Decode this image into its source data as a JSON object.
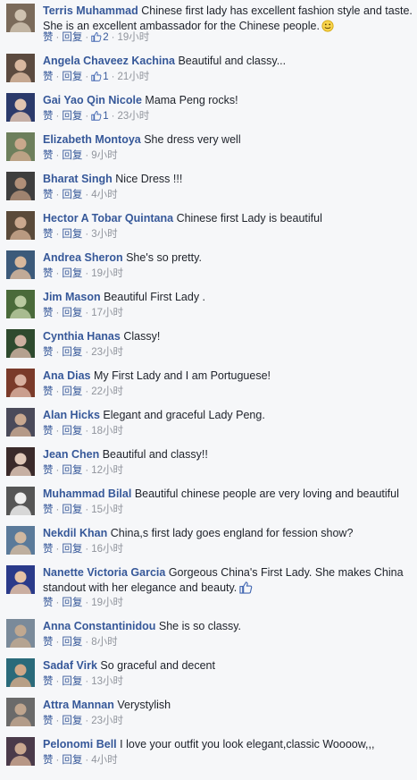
{
  "labels": {
    "like": "赞",
    "reply": "回复"
  },
  "colors": {
    "link": "#365899",
    "meta": "#90949c",
    "background": "#f6f7f9",
    "like_blue": "#4267b2"
  },
  "comments": [
    {
      "author": "Terris Muhammad",
      "text": "Chinese first lady has excellent fashion style and taste. She is an excellent ambassador for the Chinese people.",
      "trailing_icon": "smiley-emoji-icon",
      "likes": "2",
      "time": "19小时"
    },
    {
      "author": "Angela Chaveez Kachina",
      "text": "Beautiful and classy...",
      "likes": "1",
      "time": "21小时"
    },
    {
      "author": "Gai Yao Qin Nicole",
      "text": "Mama Peng rocks!",
      "likes": "1",
      "time": "23小时"
    },
    {
      "author": "Elizabeth Montoya",
      "text": "She dress very well",
      "time": "9小时"
    },
    {
      "author": "Bharat Singh",
      "text": "Nice Dress !!!",
      "time": "4小时"
    },
    {
      "author": "Hector A Tobar Quintana",
      "text": "Chinese first Lady is beautiful",
      "time": "3小时"
    },
    {
      "author": "Andrea Sheron",
      "text": "She's so pretty.",
      "time": "19小时"
    },
    {
      "author": "Jim Mason",
      "text": "Beautiful First Lady .",
      "time": "17小时"
    },
    {
      "author": "Cynthia Hanas",
      "text": "Classy!",
      "time": "23小时"
    },
    {
      "author": "Ana Dias",
      "text": "My First Lady and I am Portuguese!",
      "time": "22小时"
    },
    {
      "author": "Alan Hicks",
      "text": "Elegant and graceful Lady Peng.",
      "time": "18小时"
    },
    {
      "author": "Jean Chen",
      "text": "Beautiful and classy!!",
      "time": "12小时"
    },
    {
      "author": "Muhammad Bilal",
      "text": "Beautiful chinese people are very loving and beautiful",
      "time": "15小时"
    },
    {
      "author": "Nekdil Khan",
      "text": "China,s first lady goes england for fession show?",
      "time": "16小时"
    },
    {
      "author": "Nanette Victoria Garcia",
      "text": "Gorgeous China's First Lady. She makes China standout with her elegance and beauty.",
      "trailing_icon": "thumbs-up-emoji-icon",
      "time": "19小时"
    },
    {
      "author": "Anna Constantinidou",
      "text": "She is so classy.",
      "time": "8小时"
    },
    {
      "author": "Sadaf Virk",
      "text": "So graceful and decent",
      "time": "13小时"
    },
    {
      "author": "Attra Mannan",
      "text": "Verystylish",
      "time": "23小时"
    },
    {
      "author": "Pelonomi Bell",
      "text": "I love your outfit you look elegant,classic Woooow,,,",
      "time": "4小时"
    }
  ]
}
